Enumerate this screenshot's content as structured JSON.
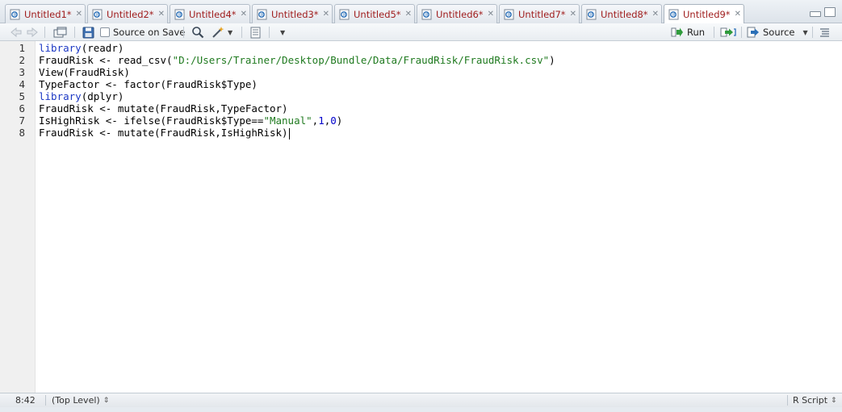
{
  "tabs": [
    {
      "label": "Untitled1*"
    },
    {
      "label": "Untitled2*"
    },
    {
      "label": "Untitled4*"
    },
    {
      "label": "Untitled3*"
    },
    {
      "label": "Untitled5*"
    },
    {
      "label": "Untitled6*"
    },
    {
      "label": "Untitled7*"
    },
    {
      "label": "Untitled8*"
    },
    {
      "label": "Untitled9*",
      "active": true
    }
  ],
  "toolbar": {
    "source_on_save": "Source on Save",
    "run": "Run",
    "source": "Source"
  },
  "code": {
    "line_numbers": [
      "1",
      "2",
      "3",
      "4",
      "5",
      "6",
      "7",
      "8"
    ],
    "lines": [
      "library(readr)",
      "FraudRisk <- read_csv(\"D:/Users/Trainer/Desktop/Bundle/Data/FraudRisk/FraudRisk.csv\")",
      "View(FraudRisk)",
      "TypeFactor <- factor(FraudRisk$Type)",
      "library(dplyr)",
      "FraudRisk <- mutate(FraudRisk,TypeFactor)",
      "IsHighRisk <- ifelse(FraudRisk$Type==\"Manual\",1,0)",
      "FraudRisk <- mutate(FraudRisk,IsHighRisk)"
    ]
  },
  "status": {
    "position": "8:42",
    "scope": "(Top Level)",
    "file_type": "R Script"
  },
  "colors": {
    "keyword": "#1c38c4",
    "string": "#1f7a1f",
    "number": "#0000cc",
    "tab_label": "#a01e1e"
  }
}
